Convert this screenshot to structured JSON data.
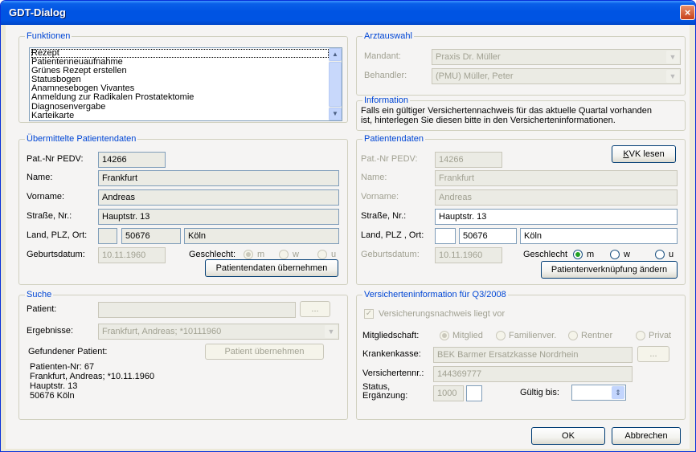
{
  "window": {
    "title": "GDT-Dialog",
    "close_symbol": "×"
  },
  "funktionen": {
    "legend": "Funktionen",
    "items": [
      "Rezept",
      "Patientenneuaufnahme",
      "Grünes Rezept erstellen",
      "Statusbogen",
      "Anamnesebogen Vivantes",
      "Anmeldung zur Radikalen Prostatektomie",
      "Diagnosenvergabe",
      "Karteikarte"
    ],
    "scroll_up": "▲",
    "scroll_down": "▼"
  },
  "arztauswahl": {
    "legend": "Arztauswahl",
    "mandant_label": "Mandant:",
    "mandant_value": "Praxis Dr. Müller",
    "behandler_label": "Behandler:",
    "behandler_value": "(PMU) Müller, Peter",
    "dropdown_symbol": "▼"
  },
  "information": {
    "legend": "Information",
    "line1": "Falls ein gültiger Versichertennachweis für das aktuelle Quartal vorhanden",
    "line2": "ist, hinterlegen Sie diesen bitte in den Versicherteninformationen."
  },
  "uebermittelte": {
    "legend": "Übermittelte Patientendaten",
    "patnr_label": "Pat.-Nr PEDV:",
    "patnr": "14266",
    "name_label": "Name:",
    "name": "Frankfurt",
    "vorname_label": "Vorname:",
    "vorname": "Andreas",
    "strasse_label": "Straße, Nr.:",
    "strasse": "Hauptstr. 13",
    "land_label": "Land, PLZ, Ort:",
    "land": "",
    "plz": "50676",
    "ort": "Köln",
    "geburt_label": "Geburtsdatum:",
    "geburt": "10.11.1960",
    "geschlecht_label": "Geschlecht:",
    "m": "m",
    "w": "w",
    "u": "u",
    "button": "Patientendaten übernehmen"
  },
  "patientendaten": {
    "legend": "Patientendaten",
    "kvk_button_k": "K",
    "kvk_button_rest": "VK lesen",
    "patnr_label": "Pat.-Nr PEDV:",
    "patnr": "14266",
    "name_label": "Name:",
    "name": "Frankfurt",
    "vorname_label": "Vorname:",
    "vorname": "Andreas",
    "strasse_label": "Straße, Nr.:",
    "strasse": "Hauptstr. 13",
    "land_label": "Land,  PLZ , Ort:",
    "land": "",
    "plz": "50676",
    "ort": "Köln",
    "geburt_label": "Geburtsdatum:",
    "geburt": "10.11.1960",
    "geschlecht_label": "Geschlecht",
    "m": "m",
    "w": "w",
    "u": "u",
    "button": "Patientenverknüpfung ändern"
  },
  "suche": {
    "legend": "Suche",
    "patient_label": "Patient:",
    "patient_value": "",
    "browse": "...",
    "ergebnisse_label": "Ergebnisse:",
    "ergebnisse_value": "Frankfurt, Andreas; *10111960",
    "gefunden_label": "Gefundener Patient:",
    "uebernehmen_button": "Patient übernehmen",
    "details": [
      "Patienten-Nr: 67",
      "Frankfurt, Andreas; *10.11.1960",
      "Hauptstr. 13",
      "50676 Köln"
    ]
  },
  "versicherung": {
    "legend": "Versicherteninformation für Q3/2008",
    "nachweis_label": "Versicherungsnachweis liegt vor",
    "check_symbol": "✓",
    "mitglied_label": "Mitgliedschaft:",
    "opt_mitglied": "Mitglied",
    "opt_familie": "Familienver.",
    "opt_rentner": "Rentner",
    "opt_privat": "Privat",
    "kasse_label": "Krankenkasse:",
    "kasse_value": "BEK Barmer Ersatzkasse Nordrhein",
    "browse": "...",
    "nr_label": "Versichertennr.:",
    "nr_value": "144369777",
    "status_label_1": "Status,",
    "status_label_2": "Ergänzung:",
    "status_value": "1000",
    "ergaenzung_value": "",
    "gueltig_label": "Gültig bis:",
    "gueltig_value": "",
    "spin_symbol": "⇕"
  },
  "footer": {
    "ok": "OK",
    "cancel": "Abbrechen"
  }
}
